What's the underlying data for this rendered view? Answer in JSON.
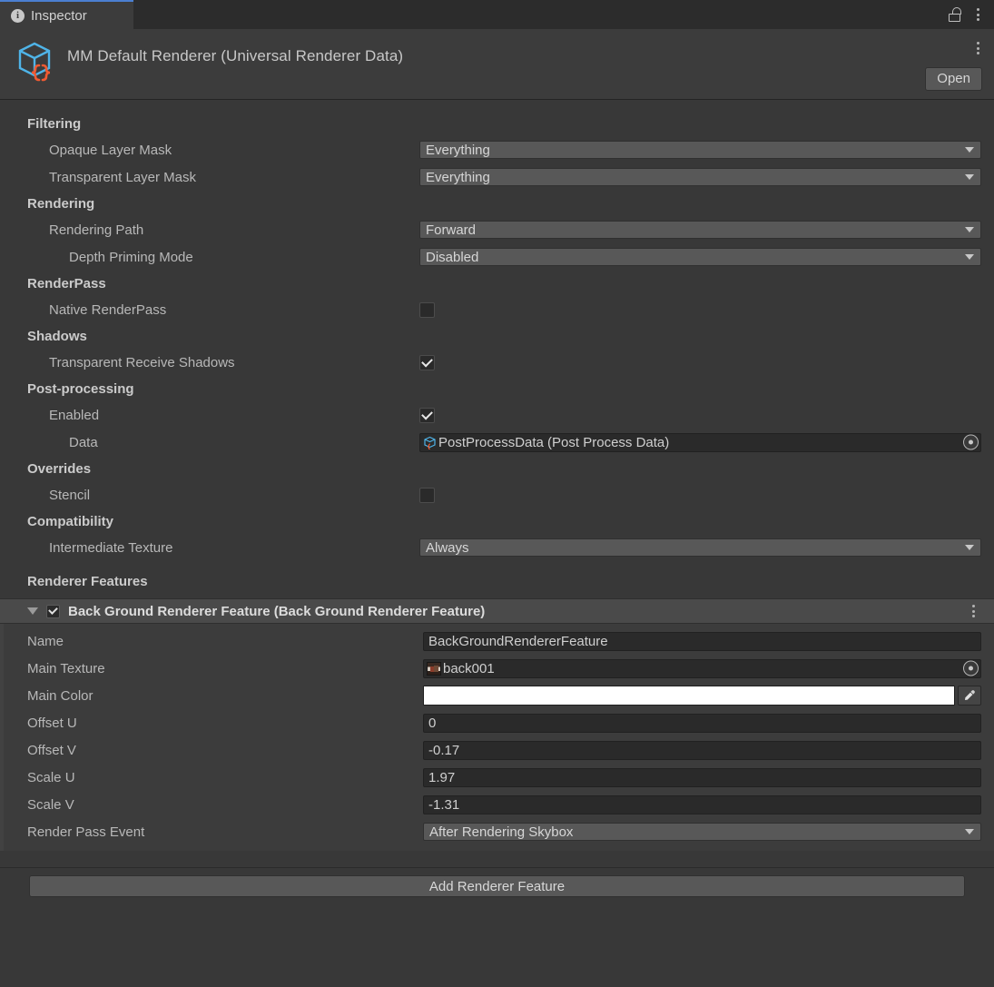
{
  "window": {
    "tab_label": "Inspector",
    "tab_icon": "info-icon",
    "lock_icon": "lock-icon",
    "menu_icon": "kebab-menu-icon"
  },
  "object_header": {
    "title": "MM Default Renderer (Universal Renderer Data)",
    "icon": "scriptable-object-icon",
    "open_label": "Open",
    "menu_icon": "kebab-menu-icon"
  },
  "sections": {
    "filtering": {
      "title": "Filtering",
      "opaque_layer_mask": {
        "label": "Opaque Layer Mask",
        "value": "Everything"
      },
      "transparent_layer_mask": {
        "label": "Transparent Layer Mask",
        "value": "Everything"
      }
    },
    "rendering": {
      "title": "Rendering",
      "rendering_path": {
        "label": "Rendering Path",
        "value": "Forward"
      },
      "depth_priming_mode": {
        "label": "Depth Priming Mode",
        "value": "Disabled"
      }
    },
    "renderpass": {
      "title": "RenderPass",
      "native_renderpass": {
        "label": "Native RenderPass",
        "checked": false
      }
    },
    "shadows": {
      "title": "Shadows",
      "transparent_receive_shadows": {
        "label": "Transparent Receive Shadows",
        "checked": true
      }
    },
    "post_processing": {
      "title": "Post-processing",
      "enabled": {
        "label": "Enabled",
        "checked": true
      },
      "data": {
        "label": "Data",
        "value": "PostProcessData (Post Process Data)"
      }
    },
    "overrides": {
      "title": "Overrides",
      "stencil": {
        "label": "Stencil",
        "checked": false
      }
    },
    "compatibility": {
      "title": "Compatibility",
      "intermediate_texture": {
        "label": "Intermediate Texture",
        "value": "Always"
      }
    },
    "renderer_features": {
      "title": "Renderer Features",
      "feature": {
        "title": "Back Ground Renderer Feature (Back Ground Renderer Feature)",
        "enabled": true,
        "expanded": true,
        "menu_icon": "kebab-menu-icon",
        "properties": {
          "name": {
            "label": "Name",
            "value": "BackGroundRendererFeature"
          },
          "main_texture": {
            "label": "Main Texture",
            "value": "back001"
          },
          "main_color": {
            "label": "Main Color",
            "value": "#FFFFFF"
          },
          "offset_u": {
            "label": "Offset U",
            "value": "0"
          },
          "offset_v": {
            "label": "Offset V",
            "value": "-0.17"
          },
          "scale_u": {
            "label": "Scale U",
            "value": "1.97"
          },
          "scale_v": {
            "label": "Scale V",
            "value": "-1.31"
          },
          "render_pass_event": {
            "label": "Render Pass Event",
            "value": "After Rendering Skybox"
          }
        }
      },
      "add_button_label": "Add Renderer Feature"
    }
  },
  "colors": {
    "accent": "#4b7fd1",
    "panel_bg": "#383838",
    "field_bg": "#2a2a2a",
    "dropdown_bg": "#585858"
  }
}
